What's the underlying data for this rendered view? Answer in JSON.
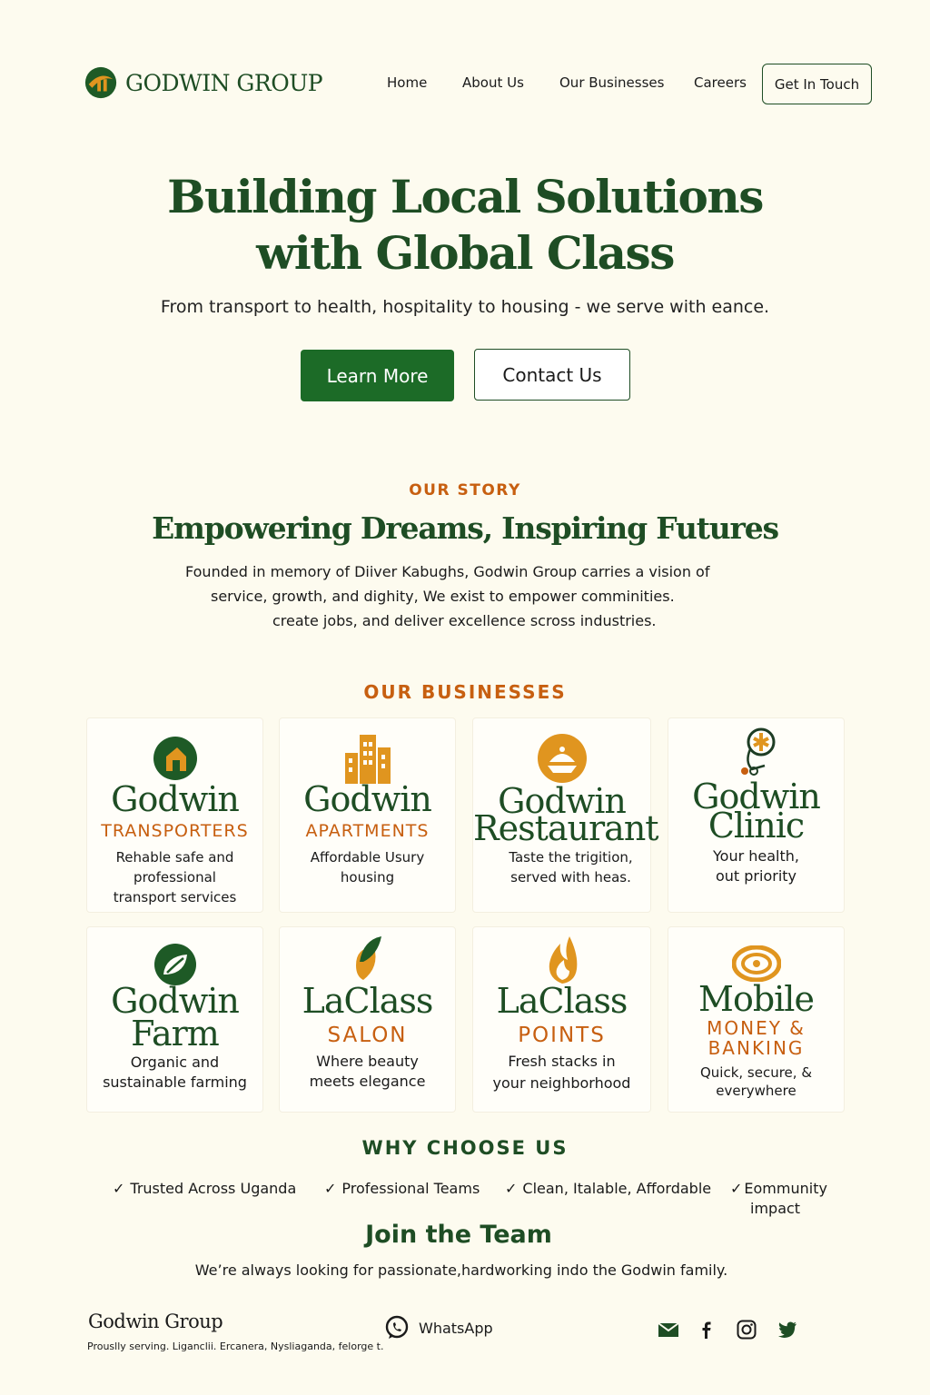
{
  "header": {
    "brand": "GODWIN GROUP",
    "nav": [
      "Home",
      "About Us",
      "Our Businesses",
      "Careers"
    ],
    "cta": "Get In Touch"
  },
  "hero": {
    "title_line1": "Building Local Solutions",
    "title_line2": "with Global Class",
    "subtitle": "From transport to health, hospitality to housing - we serve with eance.",
    "primary_button": "Learn More",
    "secondary_button": "Contact Us"
  },
  "story": {
    "eyebrow": "OUR STORY",
    "title": "Empowering Dreams, Inspiring Futures",
    "lines": [
      "Founded in memory of Diiver Kabughs, Godwin Group carries a vision of",
      "service, growth, and dighity, We exist to empower comminities.",
      "create jobs, and deliver excellence scross industries."
    ]
  },
  "businesses": {
    "eyebrow": "OUR BUSINESSES",
    "cards": [
      {
        "name": [
          "Godwin"
        ],
        "sub": [
          "TRANSPORTERS"
        ],
        "desc": [
          "Rehable safe and",
          "professional",
          "transport services"
        ]
      },
      {
        "name": [
          "Godwin"
        ],
        "sub": [
          "APARTMENTS"
        ],
        "desc": [
          "Affordable Usury",
          "housing"
        ]
      },
      {
        "name": [
          "Godwin",
          "Restaurant"
        ],
        "sub": [],
        "desc": [
          "Taste the trigition,",
          "served with heas."
        ]
      },
      {
        "name": [
          "Godwin",
          "Clinic"
        ],
        "sub": [],
        "desc": [
          "Your health,",
          "out priority"
        ]
      },
      {
        "name": [
          "Godwin",
          "Farm"
        ],
        "sub": [],
        "desc": [
          "Organic and",
          "sustainable farming"
        ]
      },
      {
        "name": [
          "LaClass"
        ],
        "sub": [
          "SALON"
        ],
        "desc": [
          "Where beauty",
          "meets elegance"
        ]
      },
      {
        "name": [
          "LaClass"
        ],
        "sub": [
          "POINTS"
        ],
        "desc": [
          "Fresh stacks in",
          "your neighborhood"
        ]
      },
      {
        "name": [
          "Mobile"
        ],
        "sub": [
          "MONEY &",
          "BANKING"
        ],
        "desc": [
          "Quick, secure, &",
          "everywhere"
        ]
      }
    ]
  },
  "why": {
    "title": "WHY CHOOSE US",
    "check": "✓",
    "items": [
      "Trusted Across Uganda",
      "Professional Teams",
      "Clean, Italable, Affordable",
      "Eommunity"
    ],
    "item4_line2": "impact"
  },
  "join": {
    "title": "Join the Team",
    "subtitle": "We’re always looking for passionate,hardworking indo the Godwin family."
  },
  "footer": {
    "name": "Godwin Group",
    "tagline": "Prouslly serving. Liganclii. Ercanera, Nysliaganda, felorge t.",
    "whatsapp": "WhatsApp",
    "socials": [
      "email-icon",
      "facebook-icon",
      "instagram-icon",
      "twitter-icon"
    ]
  },
  "colors": {
    "green": "#1e4d24",
    "button_green": "#1c6b27",
    "orange": "#c75f10",
    "background": "#fdfbef"
  }
}
